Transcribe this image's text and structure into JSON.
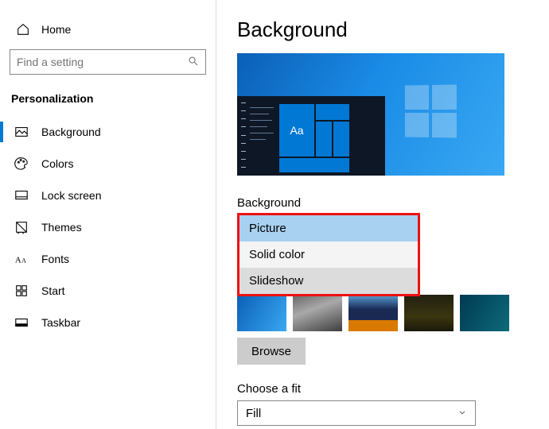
{
  "sidebar": {
    "home_label": "Home",
    "search_placeholder": "Find a setting",
    "section_title": "Personalization",
    "items": [
      {
        "label": "Background",
        "selected": true
      },
      {
        "label": "Colors"
      },
      {
        "label": "Lock screen"
      },
      {
        "label": "Themes"
      },
      {
        "label": "Fonts"
      },
      {
        "label": "Start"
      },
      {
        "label": "Taskbar"
      }
    ]
  },
  "main": {
    "title": "Background",
    "preview_tile_text": "Aa",
    "bg_dropdown_label": "Background",
    "bg_options": {
      "picture": "Picture",
      "solid": "Solid color",
      "slideshow": "Slideshow"
    },
    "browse_label": "Browse",
    "fit_label": "Choose a fit",
    "fit_value": "Fill"
  }
}
